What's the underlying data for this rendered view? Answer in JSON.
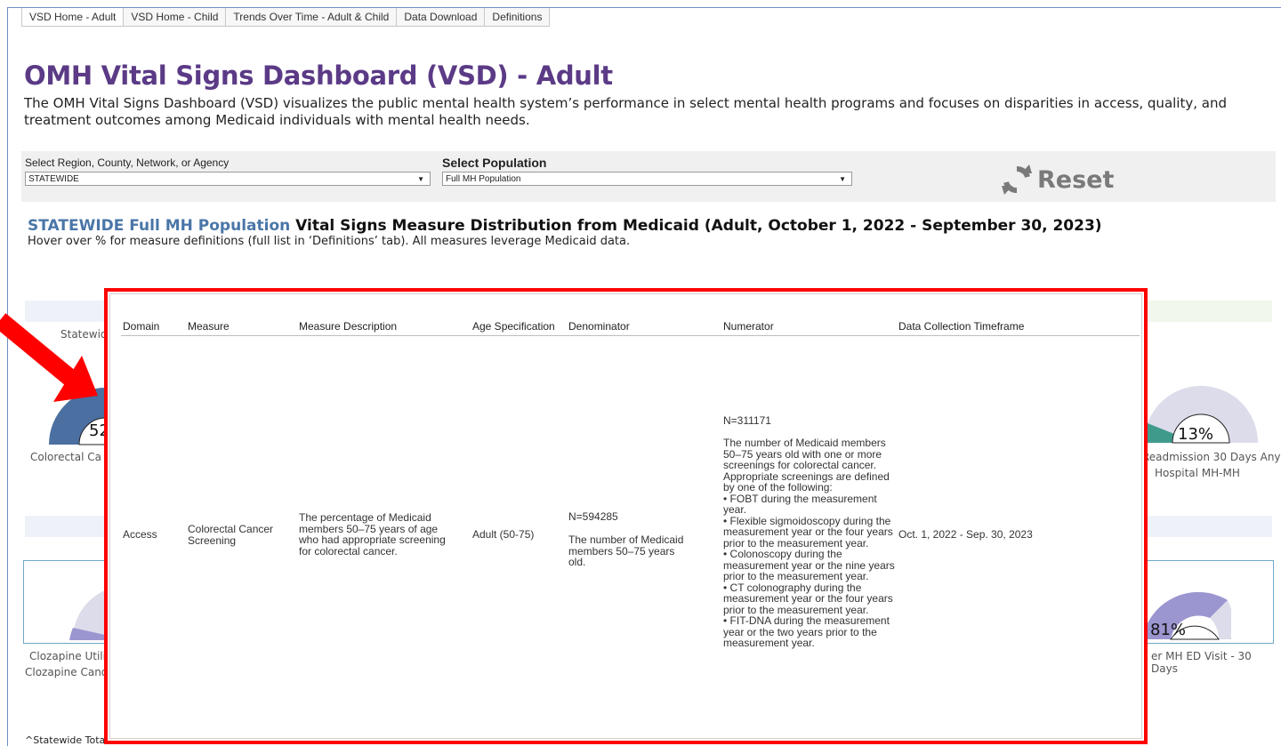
{
  "tabs": [
    "VSD Home - Adult",
    "VSD Home - Child",
    "Trends Over Time - Adult & Child",
    "Data Download",
    "Definitions"
  ],
  "page": {
    "title": "OMH Vital Signs Dashboard (VSD) - Adult",
    "description": "The OMH Vital Signs Dashboard (VSD) visualizes the public mental health system’s performance in select mental health programs and focuses on disparities in access, quality, and treatment outcomes among Medicaid individuals with mental health needs."
  },
  "filters": {
    "region_label": "Select Region, County, Network, or Agency",
    "region_value": "STATEWIDE",
    "population_label": "Select Population",
    "population_value": "Full MH Population",
    "reset_label": "Reset"
  },
  "section": {
    "highlight": "STATEWIDE Full MH Population",
    "title_rest": " Vital Signs Measure Distribution from Medicaid (Adult, October 1, 2022 - September 30, 2023)",
    "hint": "Hover over % for measure definitions (full list in ‘Definitions’ tab). All measures leverage Medicaid data."
  },
  "background": {
    "statewide_partial": "Statewid",
    "g1_value": "52",
    "g1_label": "Colorectal Ca",
    "g2_value": "13%",
    "g2_label_line1": "Readmission 30 Days Any",
    "g2_label_line2": "Hospital MH-MH",
    "g3_label_line1": "Clozapine Utili",
    "g3_label_line2": "Clozapine Cand",
    "g4_value": "81%",
    "g4_label": "er MH ED Visit - 30 Days",
    "footnote": "^Statewide Tota"
  },
  "tooltip": {
    "headers": [
      "Domain",
      "Measure",
      "Measure Description",
      "Age Specification",
      "Denominator",
      "Numerator",
      "Data Collection Timeframe"
    ],
    "row": {
      "domain": "Access",
      "measure": "Colorectal Cancer Screening",
      "description": "The percentage of Medicaid members 50–75 years of age who had appropriate screening for colorectal cancer.",
      "age": "Adult (50-75)",
      "denominator_n": "N=594285",
      "denominator_text": "The number of Medicaid members 50–75 years old.",
      "numerator_n": "N=311171",
      "numerator_text": "The number of Medicaid members 50–75 years old with one or more screenings for colorectal cancer. Appropriate screenings are defined by one of the following:\n• FOBT during the measurement year.\n• Flexible sigmoidoscopy during the measurement year or the four years prior to the measurement year.\n• Colonoscopy during the measurement year or the nine years prior to the measurement year.\n• CT colonography during the measurement year or the four years prior to the measurement year.\n• FIT-DNA during the measurement year or the two years prior to the measurement year.",
      "timeframe": "Oct. 1, 2022 - Sep. 30, 2023"
    }
  },
  "colors": {
    "title": "#5b3a86",
    "highlight": "#4a76a8",
    "annotation": "#ff0000",
    "gauge_blue": "#4a6fa0",
    "gauge_teal": "#3f9a8c",
    "gauge_purple": "#9b96d0"
  }
}
